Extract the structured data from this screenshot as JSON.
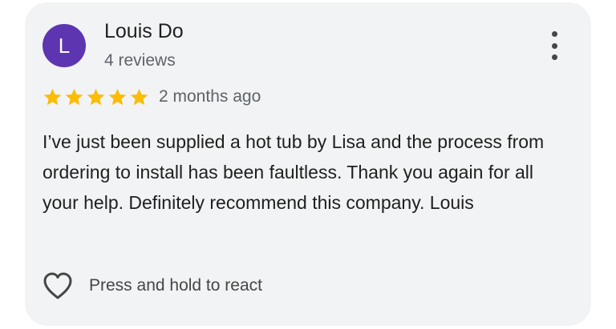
{
  "review": {
    "avatar_letter": "L",
    "avatar_color": "#5e35b1",
    "reviewer_name": "Louis Do",
    "review_count": "4 reviews",
    "rating": 5,
    "rating_max": 5,
    "star_color": "#fbbc04",
    "time_ago": "2 months ago",
    "text": "I’ve just been supplied a hot tub by Lisa and the process from ordering to install has been faultless. Thank you again for all your help. Definitely recommend this company. Louis"
  },
  "actions": {
    "more_icon": "more-vert-icon",
    "react_icon": "heart-outline-icon",
    "react_label": "Press and hold to react"
  }
}
